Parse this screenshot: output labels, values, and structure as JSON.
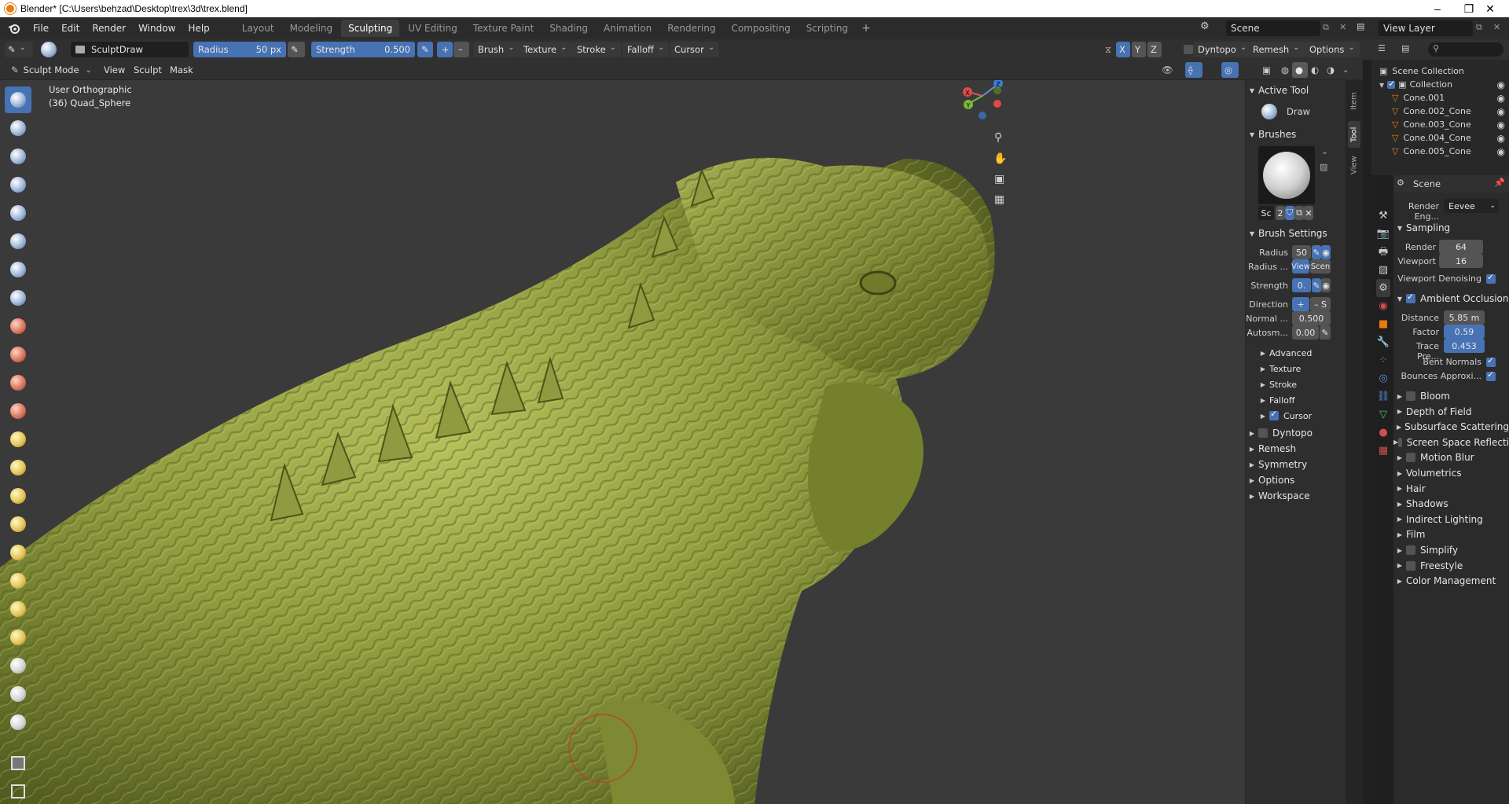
{
  "window": {
    "title": "Blender* [C:\\Users\\behzad\\Desktop\\trex\\3d\\trex.blend]",
    "controls": [
      "–",
      "❐",
      "✕"
    ]
  },
  "menu": [
    "File",
    "Edit",
    "Render",
    "Window",
    "Help"
  ],
  "workspaces": [
    "Layout",
    "Modeling",
    "Sculpting",
    "UV Editing",
    "Texture Paint",
    "Shading",
    "Animation",
    "Rendering",
    "Compositing",
    "Scripting"
  ],
  "active_workspace": "Sculpting",
  "scene_selector": "Scene",
  "view_layer": "View Layer",
  "tool_header": {
    "brush_name": "SculptDraw",
    "radius_label": "Radius",
    "radius_value": "50 px",
    "strength_label": "Strength",
    "strength_value": "0.500",
    "add": "+",
    "subtract": "–",
    "menus": [
      "Brush",
      "Texture",
      "Stroke",
      "Falloff",
      "Cursor"
    ],
    "axes": [
      "X",
      "Y",
      "Z"
    ],
    "right_menus": [
      "Dyntopo",
      "Remesh",
      "Options"
    ]
  },
  "mode_header": {
    "mode": "Sculpt Mode",
    "menus": [
      "View",
      "Sculpt",
      "Mask"
    ]
  },
  "viewport": {
    "view_name": "User Orthographic",
    "object_info": "(36) Quad_Sphere",
    "gizmo_axes": [
      "X",
      "Y",
      "Z"
    ]
  },
  "npanel": {
    "tabs": [
      "Item",
      "Tool",
      "View"
    ],
    "active_tool_header": "Active Tool",
    "active_tool": "Draw",
    "brushes_header": "Brushes",
    "brush_slot_short": "Sc",
    "brush_users": "2",
    "brush_settings_header": "Brush Settings",
    "radius_label": "Radius",
    "radius_value": "50",
    "radius_unit_label": "Radius ...",
    "radius_unit_options": [
      "View",
      "Scen"
    ],
    "strength_label": "Strength",
    "strength_value": "0.",
    "direction_label": "Direction",
    "direction_options": [
      "+",
      "– S"
    ],
    "normal_label": "Normal ...",
    "normal_value": "0.500",
    "autosmooth_label": "Autosm...",
    "autosmooth_value": "0.00",
    "subpanels": [
      "Advanced",
      "Texture",
      "Stroke",
      "Falloff",
      "Cursor"
    ],
    "panels": [
      "Dyntopo",
      "Remesh",
      "Symmetry",
      "Options",
      "Workspace"
    ]
  },
  "outliner": {
    "root": "Scene Collection",
    "collection": "Collection",
    "items": [
      "Cone.001",
      "Cone.002_Cone",
      "Cone.003_Cone",
      "Cone.004_Cone",
      "Cone.005_Cone"
    ]
  },
  "properties": {
    "context": "Scene",
    "render_engine_label": "Render Eng...",
    "render_engine": "Eevee",
    "sampling_header": "Sampling",
    "render_label": "Render",
    "render_value": "64",
    "viewport_label": "Viewport",
    "viewport_value": "16",
    "denoise_label": "Viewport Denoising",
    "ao_header": "Ambient Occlusion",
    "distance_label": "Distance",
    "distance_value": "5.85 m",
    "factor_label": "Factor",
    "factor_value": "0.59",
    "trace_label": "Trace Pre...",
    "trace_value": "0.453",
    "bent_normals_label": "Bent Normals",
    "bounces_label": "Bounces Approxi...",
    "sections": [
      {
        "label": "Bloom",
        "checkbox": true
      },
      {
        "label": "Depth of Field",
        "checkbox": false
      },
      {
        "label": "Subsurface Scattering",
        "checkbox": false
      },
      {
        "label": "Screen Space Reflecti",
        "checkbox": true
      },
      {
        "label": "Motion Blur",
        "checkbox": true
      },
      {
        "label": "Volumetrics",
        "checkbox": false
      },
      {
        "label": "Hair",
        "checkbox": false
      },
      {
        "label": "Shadows",
        "checkbox": false
      },
      {
        "label": "Indirect Lighting",
        "checkbox": false
      },
      {
        "label": "Film",
        "checkbox": false
      },
      {
        "label": "Simplify",
        "checkbox": true
      },
      {
        "label": "Freestyle",
        "checkbox": true
      },
      {
        "label": "Color Management",
        "checkbox": false
      }
    ]
  },
  "colors": {
    "accent": "#4772b3",
    "model_green": "#8e9a3e",
    "viewport_bg": "#3a3a3a",
    "blender_orange": "#e87d0d"
  }
}
